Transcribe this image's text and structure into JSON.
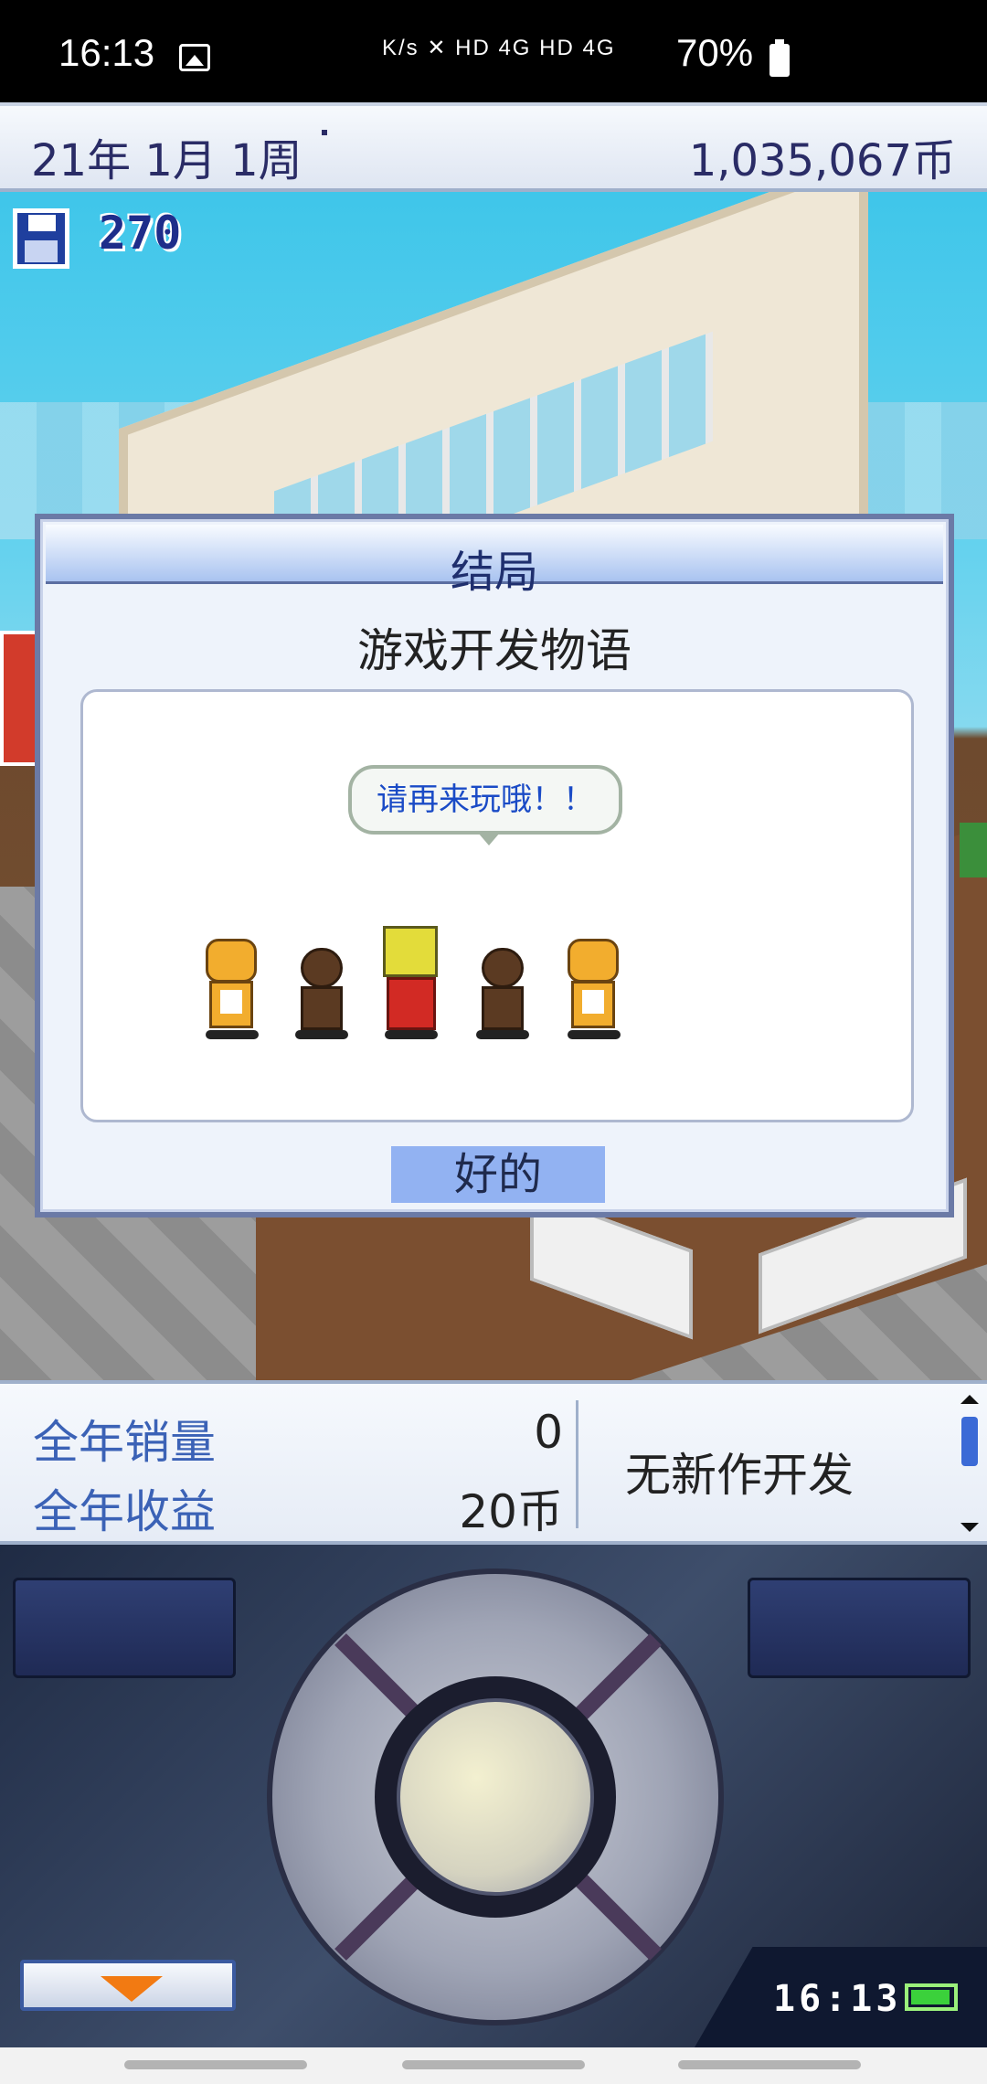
{
  "status_bar": {
    "time": "16:13",
    "indicators": "K/s ✕ HD 4G HD 4G",
    "battery": "70%"
  },
  "top_bar": {
    "date": "21年 1月 1周",
    "money": "1,035,067币"
  },
  "save_counter": "270",
  "dialog": {
    "title": "结局",
    "game_name": "游戏开发物语",
    "speech": "请再来玩哦！！",
    "ok_button": "好的"
  },
  "stats": {
    "annual_sales_label": "全年销量",
    "annual_sales_value": "0",
    "annual_profit_label": "全年收益",
    "annual_profit_value": "20币",
    "dev_status": "无新作开发"
  },
  "game_clock": "16:13",
  "colors": {
    "dialog_header": "#a9c3f0",
    "ok_button": "#92b2f2",
    "accent_blue": "#3b62b6",
    "arrow_orange": "#f27a12"
  }
}
